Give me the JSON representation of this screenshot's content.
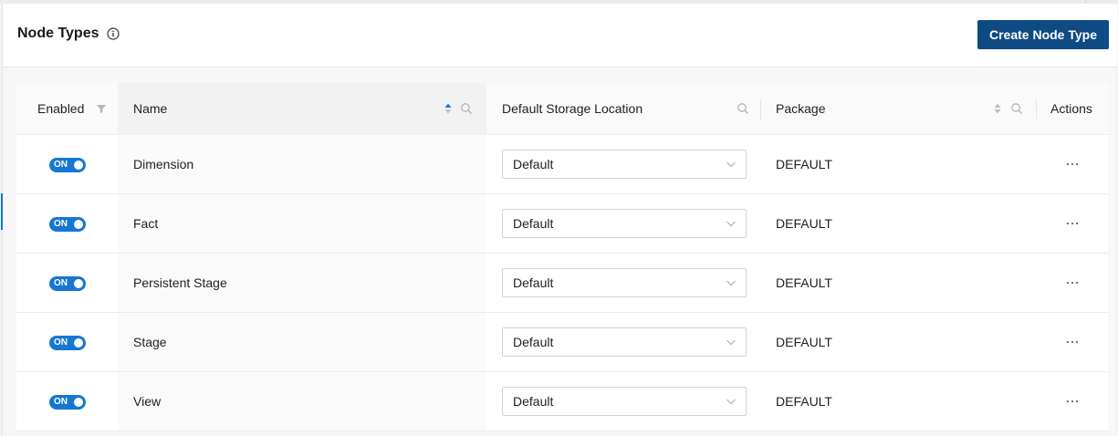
{
  "header": {
    "title": "Node Types",
    "info_icon": "info-circle-icon",
    "create_button_label": "Create Node Type"
  },
  "table": {
    "columns": {
      "enabled": "Enabled",
      "name": "Name",
      "storage": "Default Storage Location",
      "package": "Package",
      "actions": "Actions"
    },
    "sorted_column": "name",
    "sort_color": "#1677d2",
    "rows": [
      {
        "enabled_label": "ON",
        "name": "Dimension",
        "storage": "Default",
        "package": "DEFAULT"
      },
      {
        "enabled_label": "ON",
        "name": "Fact",
        "storage": "Default",
        "package": "DEFAULT"
      },
      {
        "enabled_label": "ON",
        "name": "Persistent Stage",
        "storage": "Default",
        "package": "DEFAULT"
      },
      {
        "enabled_label": "ON",
        "name": "Stage",
        "storage": "Default",
        "package": "DEFAULT"
      },
      {
        "enabled_label": "ON",
        "name": "View",
        "storage": "Default",
        "package": "DEFAULT"
      }
    ]
  },
  "colors": {
    "primary_button": "#0e4a84",
    "toggle_on": "#1677d2"
  }
}
